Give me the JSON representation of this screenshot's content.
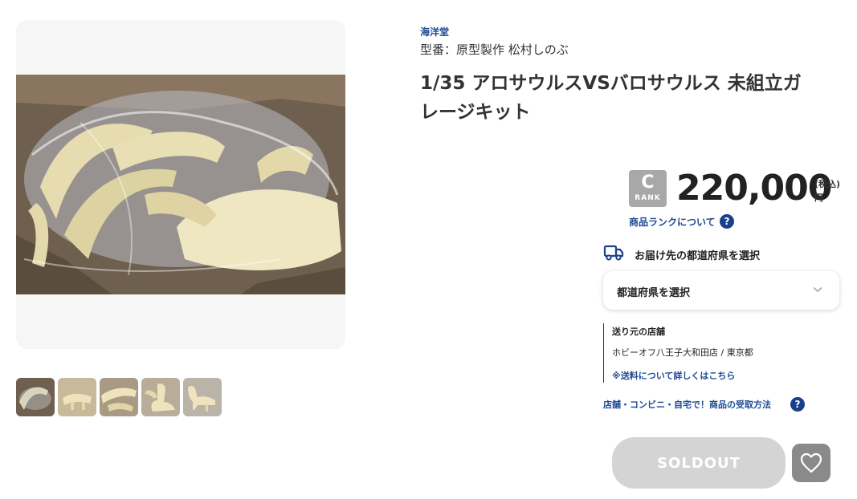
{
  "product": {
    "brand": "海洋堂",
    "model": "型番：原型製作 松村しのぶ",
    "title": "1/35 アロサウルスVSバロサウルス 未組立ガレージキット"
  },
  "gallery": {
    "main_image": "product-photo-box-of-parts",
    "thumbnails": [
      "thumb-1",
      "thumb-2",
      "thumb-3",
      "thumb-4",
      "thumb-5"
    ]
  },
  "pricing": {
    "rank_letter": "C",
    "rank_sub": "RANK",
    "price": "220,000",
    "tax_label": "(税込)",
    "currency": "円",
    "rank_link": "商品ランクについて",
    "help_glyph": "?"
  },
  "delivery": {
    "label": "お届け先の都道府県を選択",
    "select_value": "都道府県を選択"
  },
  "shipping": {
    "title": "送り元の店舗",
    "store": "ホビーオフ八王子大和田店 / 東京都",
    "link": "※送料について詳しくはこちら"
  },
  "pickup": {
    "link": "店舗・コンビニ・自宅で！商品の受取方法"
  },
  "actions": {
    "soldout_label": "SOLDOUT"
  },
  "colors": {
    "accent": "#1f4a94",
    "help_icon": "#1a3f8c",
    "soldout_bg": "#d4d4d4",
    "fav_bg": "#8a8a8a"
  }
}
